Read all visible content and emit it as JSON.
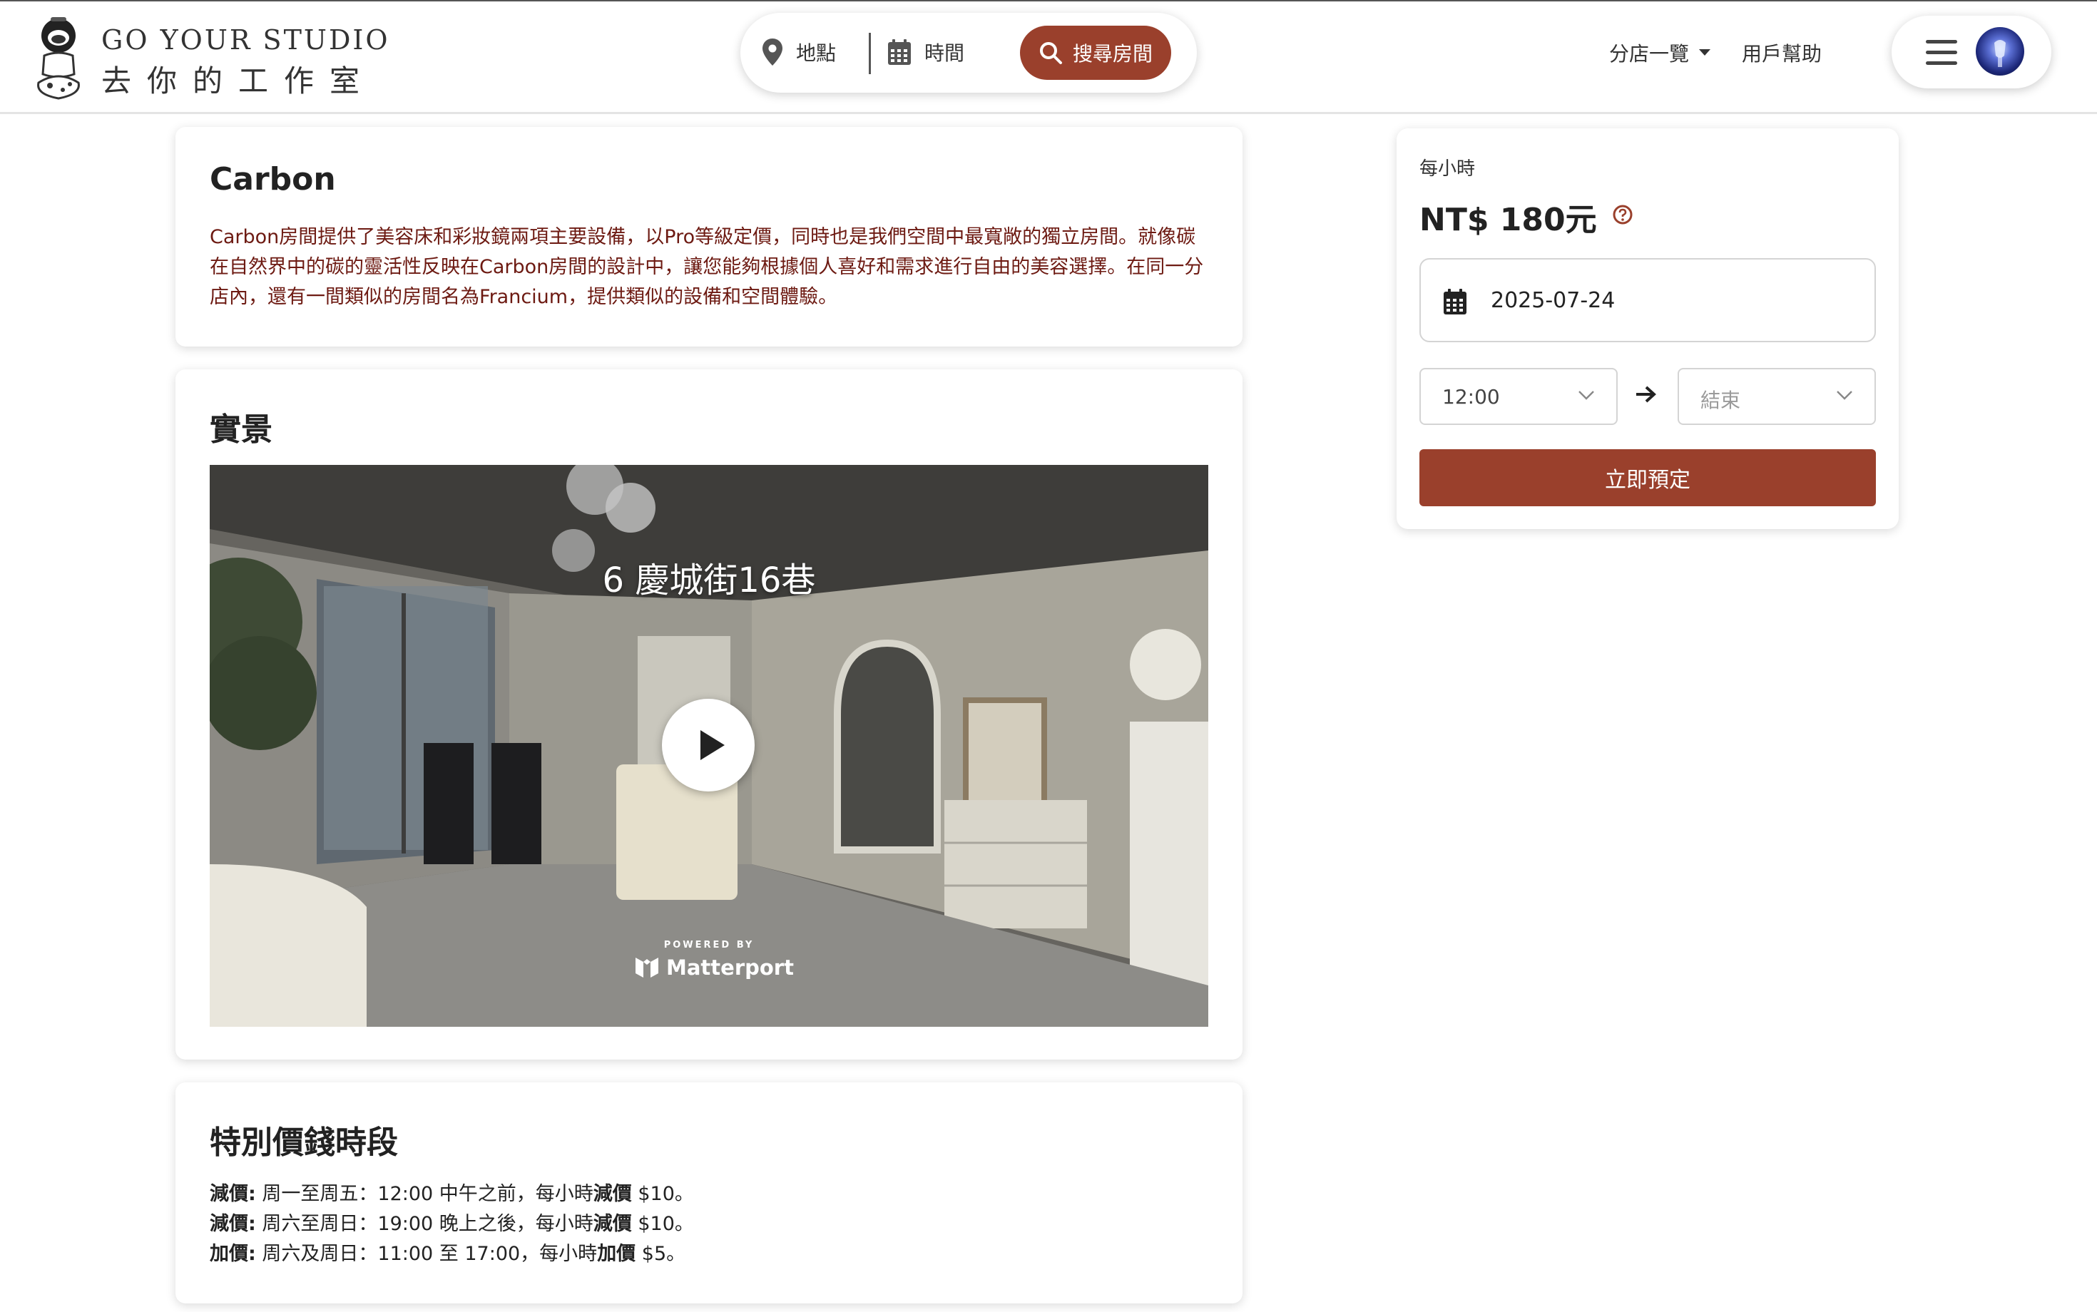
{
  "brand": {
    "name_en": "GO YOUR STUDIO",
    "name_zh": "去你的工作室"
  },
  "search": {
    "location_label": "地點",
    "time_label": "時間",
    "button_label": "搜尋房間"
  },
  "nav": {
    "branches_label": "分店一覽",
    "help_label": "用戶幫助"
  },
  "room": {
    "name": "Carbon",
    "description": "Carbon房間提供了美容床和彩妝鏡兩項主要設備，以Pro等級定價，同時也是我們空間中最寬敞的獨立房間。就像碳在自然界中的碳的靈活性反映在Carbon房間的設計中，讓您能夠根據個人喜好和需求進行自由的美容選擇。在同一分店內，還有一間類似的房間名為Francium，提供類似的設備和空間體驗。"
  },
  "scene": {
    "title": "實景",
    "tour_title": "6 慶城街16巷",
    "powered_by": "POWERED BY",
    "provider": "Matterport"
  },
  "special_pricing": {
    "title": "特別價錢時段",
    "rules": [
      {
        "tag": "減價:",
        "text_before": " 周一至周五：12:00 中午之前，每小時",
        "emph": "減價",
        "text_after": " $10。"
      },
      {
        "tag": "減價:",
        "text_before": " 周六至周日：19:00 晚上之後，每小時",
        "emph": "減價",
        "text_after": " $10。"
      },
      {
        "tag": "加價:",
        "text_before": " 周六及周日：11:00 至 17:00，每小時",
        "emph": "加價",
        "text_after": " $5。"
      }
    ]
  },
  "booking": {
    "unit_label": "每小時",
    "price": "NT$ 180元",
    "date": "2025-07-24",
    "start_time": "12:00",
    "end_placeholder": "結束",
    "cta": "立即預定"
  },
  "colors": {
    "accent": "#9a402c",
    "description_text": "#6d1a12"
  }
}
